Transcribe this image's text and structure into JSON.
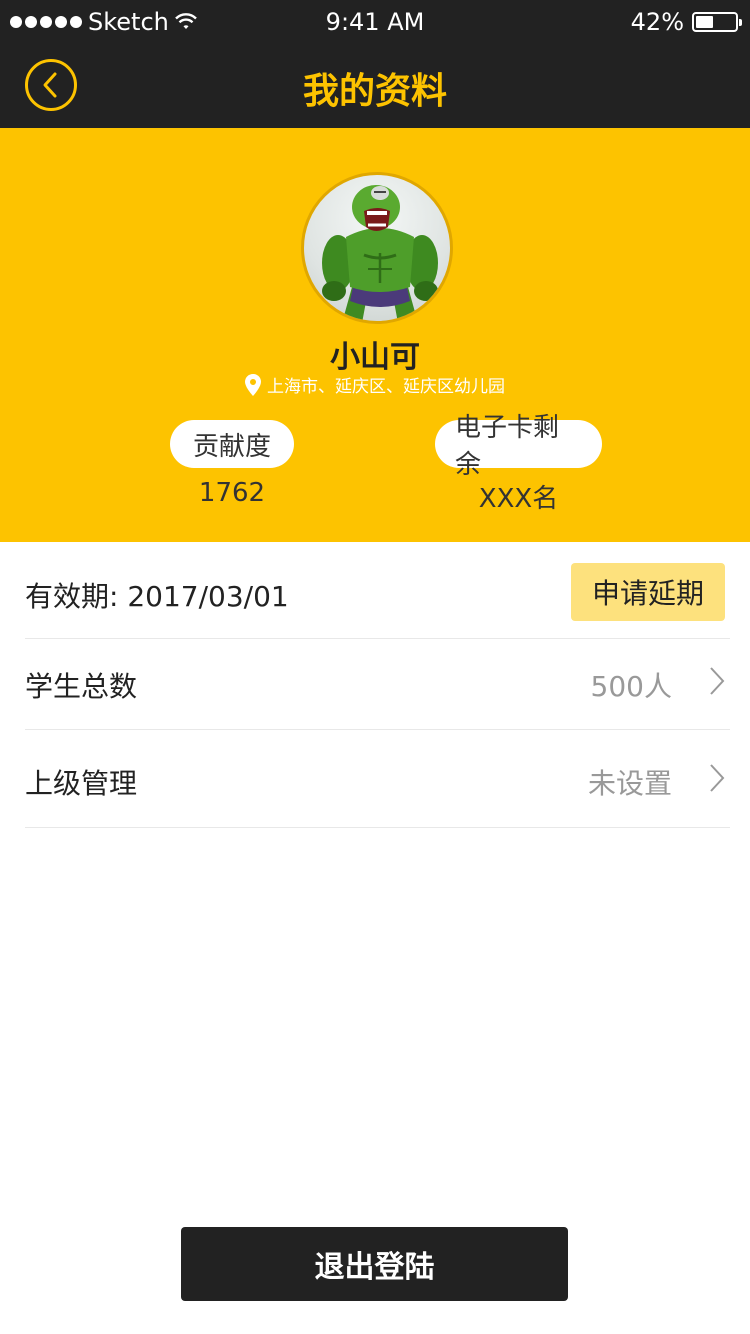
{
  "status_bar": {
    "carrier": "Sketch",
    "time": "9:41 AM",
    "battery": "42%"
  },
  "nav": {
    "title": "我的资料",
    "back_icon": "chevron-left-icon"
  },
  "profile": {
    "name": "小山可",
    "location": "上海市、延庆区、延庆区幼儿园",
    "location_icon": "map-pin-icon",
    "stats": [
      {
        "label": "贡献度",
        "value": "1762"
      },
      {
        "label": "电子卡剩余",
        "value": "XXX名"
      }
    ]
  },
  "rows": {
    "validity": {
      "label": "有效期: 2017/03/01",
      "button": "申请延期"
    },
    "students": {
      "label": "学生总数",
      "value": "500人"
    },
    "superior": {
      "label": "上级管理",
      "value": "未设置"
    }
  },
  "logout_label": "退出登陆",
  "colors": {
    "accent": "#fdc300",
    "dark": "#222222",
    "button_light": "#fde17d"
  }
}
